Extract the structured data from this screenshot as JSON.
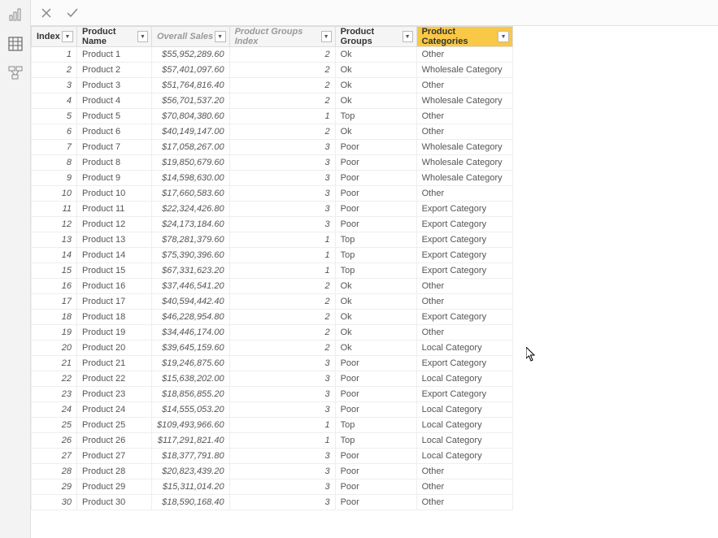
{
  "columns": [
    {
      "label": "Index",
      "greyed": false,
      "highlighted": false
    },
    {
      "label": "Product Name",
      "greyed": false,
      "highlighted": false
    },
    {
      "label": "Overall Sales",
      "greyed": true,
      "highlighted": false
    },
    {
      "label": "Product Groups Index",
      "greyed": true,
      "highlighted": false
    },
    {
      "label": "Product Groups",
      "greyed": false,
      "highlighted": false
    },
    {
      "label": "Product Categories",
      "greyed": false,
      "highlighted": true
    }
  ],
  "rows": [
    {
      "index": 1,
      "name": "Product 1",
      "sales": "$55,952,289.60",
      "pgi": 2,
      "pg": "Ok",
      "pc": "Other"
    },
    {
      "index": 2,
      "name": "Product 2",
      "sales": "$57,401,097.60",
      "pgi": 2,
      "pg": "Ok",
      "pc": "Wholesale Category"
    },
    {
      "index": 3,
      "name": "Product 3",
      "sales": "$51,764,816.40",
      "pgi": 2,
      "pg": "Ok",
      "pc": "Other"
    },
    {
      "index": 4,
      "name": "Product 4",
      "sales": "$56,701,537.20",
      "pgi": 2,
      "pg": "Ok",
      "pc": "Wholesale Category"
    },
    {
      "index": 5,
      "name": "Product 5",
      "sales": "$70,804,380.60",
      "pgi": 1,
      "pg": "Top",
      "pc": "Other"
    },
    {
      "index": 6,
      "name": "Product 6",
      "sales": "$40,149,147.00",
      "pgi": 2,
      "pg": "Ok",
      "pc": "Other"
    },
    {
      "index": 7,
      "name": "Product 7",
      "sales": "$17,058,267.00",
      "pgi": 3,
      "pg": "Poor",
      "pc": "Wholesale Category"
    },
    {
      "index": 8,
      "name": "Product 8",
      "sales": "$19,850,679.60",
      "pgi": 3,
      "pg": "Poor",
      "pc": "Wholesale Category"
    },
    {
      "index": 9,
      "name": "Product 9",
      "sales": "$14,598,630.00",
      "pgi": 3,
      "pg": "Poor",
      "pc": "Wholesale Category"
    },
    {
      "index": 10,
      "name": "Product 10",
      "sales": "$17,660,583.60",
      "pgi": 3,
      "pg": "Poor",
      "pc": "Other"
    },
    {
      "index": 11,
      "name": "Product 11",
      "sales": "$22,324,426.80",
      "pgi": 3,
      "pg": "Poor",
      "pc": "Export Category"
    },
    {
      "index": 12,
      "name": "Product 12",
      "sales": "$24,173,184.60",
      "pgi": 3,
      "pg": "Poor",
      "pc": "Export Category"
    },
    {
      "index": 13,
      "name": "Product 13",
      "sales": "$78,281,379.60",
      "pgi": 1,
      "pg": "Top",
      "pc": "Export Category"
    },
    {
      "index": 14,
      "name": "Product 14",
      "sales": "$75,390,396.60",
      "pgi": 1,
      "pg": "Top",
      "pc": "Export Category"
    },
    {
      "index": 15,
      "name": "Product 15",
      "sales": "$67,331,623.20",
      "pgi": 1,
      "pg": "Top",
      "pc": "Export Category"
    },
    {
      "index": 16,
      "name": "Product 16",
      "sales": "$37,446,541.20",
      "pgi": 2,
      "pg": "Ok",
      "pc": "Other"
    },
    {
      "index": 17,
      "name": "Product 17",
      "sales": "$40,594,442.40",
      "pgi": 2,
      "pg": "Ok",
      "pc": "Other"
    },
    {
      "index": 18,
      "name": "Product 18",
      "sales": "$46,228,954.80",
      "pgi": 2,
      "pg": "Ok",
      "pc": "Export Category"
    },
    {
      "index": 19,
      "name": "Product 19",
      "sales": "$34,446,174.00",
      "pgi": 2,
      "pg": "Ok",
      "pc": "Other"
    },
    {
      "index": 20,
      "name": "Product 20",
      "sales": "$39,645,159.60",
      "pgi": 2,
      "pg": "Ok",
      "pc": "Local Category"
    },
    {
      "index": 21,
      "name": "Product 21",
      "sales": "$19,246,875.60",
      "pgi": 3,
      "pg": "Poor",
      "pc": "Export Category"
    },
    {
      "index": 22,
      "name": "Product 22",
      "sales": "$15,638,202.00",
      "pgi": 3,
      "pg": "Poor",
      "pc": "Local Category"
    },
    {
      "index": 23,
      "name": "Product 23",
      "sales": "$18,856,855.20",
      "pgi": 3,
      "pg": "Poor",
      "pc": "Export Category"
    },
    {
      "index": 24,
      "name": "Product 24",
      "sales": "$14,555,053.20",
      "pgi": 3,
      "pg": "Poor",
      "pc": "Local Category"
    },
    {
      "index": 25,
      "name": "Product 25",
      "sales": "$109,493,966.60",
      "pgi": 1,
      "pg": "Top",
      "pc": "Local Category"
    },
    {
      "index": 26,
      "name": "Product 26",
      "sales": "$117,291,821.40",
      "pgi": 1,
      "pg": "Top",
      "pc": "Local Category"
    },
    {
      "index": 27,
      "name": "Product 27",
      "sales": "$18,377,791.80",
      "pgi": 3,
      "pg": "Poor",
      "pc": "Local Category"
    },
    {
      "index": 28,
      "name": "Product 28",
      "sales": "$20,823,439.20",
      "pgi": 3,
      "pg": "Poor",
      "pc": "Other"
    },
    {
      "index": 29,
      "name": "Product 29",
      "sales": "$15,311,014.20",
      "pgi": 3,
      "pg": "Poor",
      "pc": "Other"
    },
    {
      "index": 30,
      "name": "Product 30",
      "sales": "$18,590,168.40",
      "pgi": 3,
      "pg": "Poor",
      "pc": "Other"
    }
  ]
}
